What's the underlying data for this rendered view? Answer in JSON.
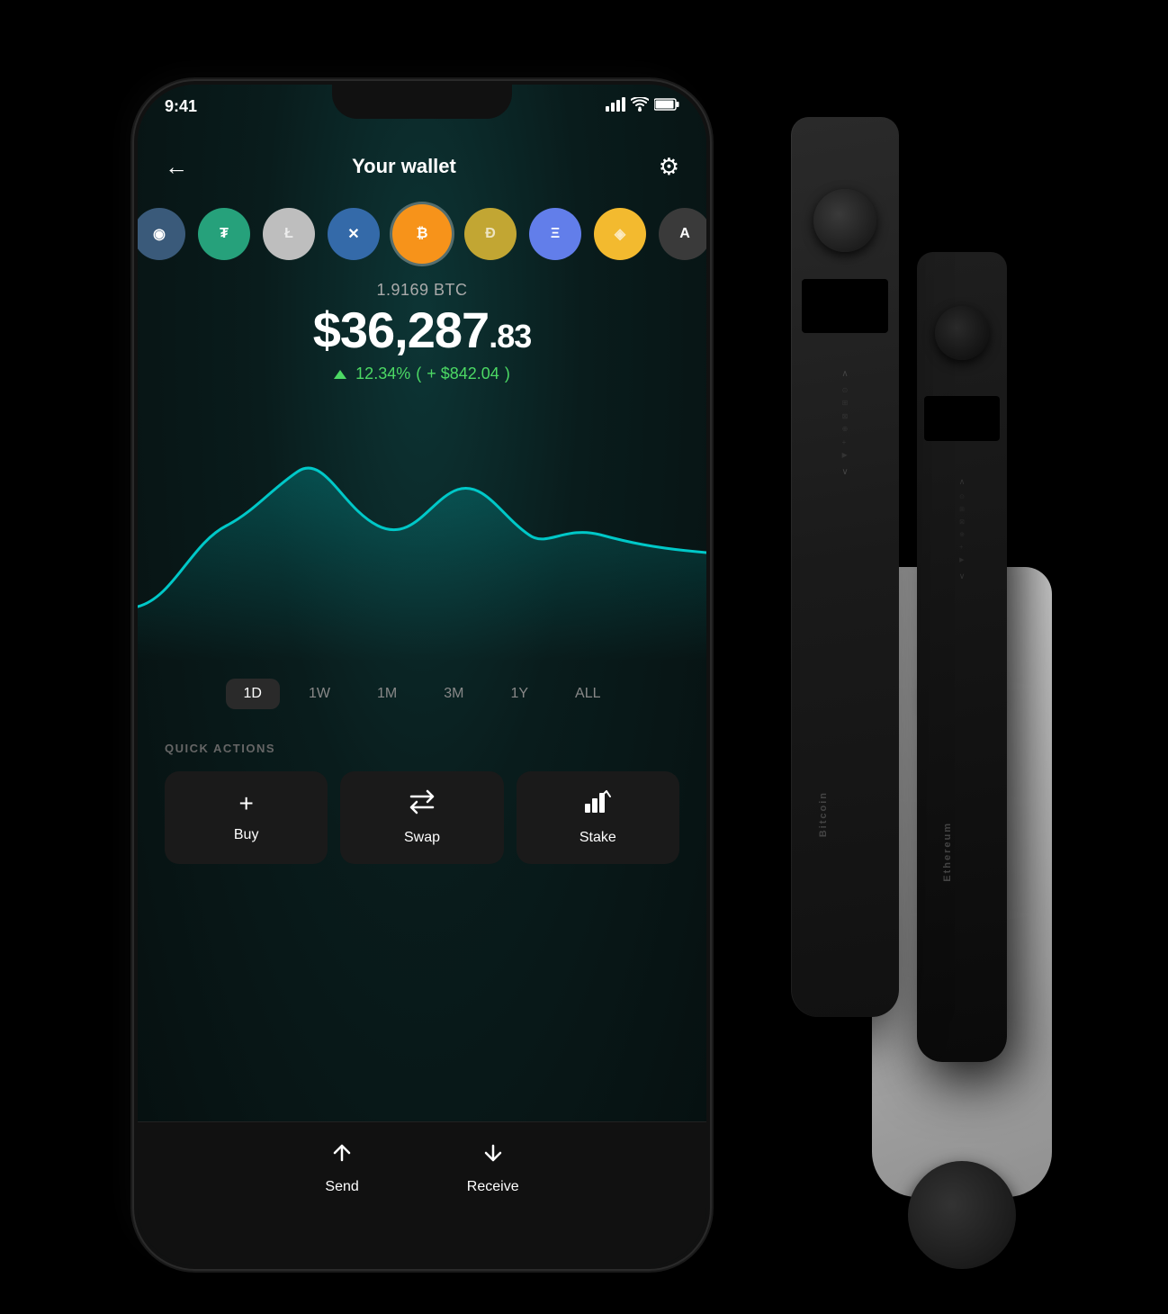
{
  "status_bar": {
    "time": "9:41",
    "signal": "▐▌▌",
    "wifi": "WiFi",
    "battery": "Battery"
  },
  "header": {
    "back_label": "←",
    "title": "Your wallet",
    "settings_label": "⚙"
  },
  "coins": [
    {
      "id": "other",
      "symbol": "◉",
      "class": "coin-other",
      "active": false
    },
    {
      "id": "usdt",
      "symbol": "₮",
      "class": "coin-usdt",
      "active": false
    },
    {
      "id": "ltc",
      "symbol": "Ł",
      "class": "coin-ltc",
      "active": false
    },
    {
      "id": "xrp",
      "symbol": "✕",
      "class": "coin-xrp",
      "active": false
    },
    {
      "id": "btc",
      "symbol": "₿",
      "class": "coin-btc",
      "active": true
    },
    {
      "id": "doge",
      "symbol": "Ð",
      "class": "coin-doge",
      "active": false
    },
    {
      "id": "eth",
      "symbol": "Ξ",
      "class": "coin-eth",
      "active": false
    },
    {
      "id": "bnb",
      "symbol": "◈",
      "class": "coin-bnb",
      "active": false
    },
    {
      "id": "algo",
      "symbol": "A",
      "class": "coin-algo",
      "active": false
    }
  ],
  "balance": {
    "btc_amount": "1.9169 BTC",
    "usd_whole": "$36,287",
    "usd_cents": ".83",
    "change_percent": "12.34%",
    "change_usd": "+ $842.04"
  },
  "chart": {
    "label": "Price chart"
  },
  "time_periods": [
    {
      "label": "1D",
      "active": true
    },
    {
      "label": "1W",
      "active": false
    },
    {
      "label": "1M",
      "active": false
    },
    {
      "label": "3M",
      "active": false
    },
    {
      "label": "1Y",
      "active": false
    },
    {
      "label": "ALL",
      "active": false
    }
  ],
  "quick_actions": {
    "section_label": "QUICK ACTIONS",
    "buttons": [
      {
        "id": "buy",
        "icon": "+",
        "label": "Buy"
      },
      {
        "id": "swap",
        "icon": "⇄",
        "label": "Swap"
      },
      {
        "id": "stake",
        "icon": "↑↑↑",
        "label": "Stake"
      }
    ]
  },
  "bottom_bar": {
    "send": {
      "icon": "↑",
      "label": "Send"
    },
    "receive": {
      "icon": "↓",
      "label": "Receive"
    }
  }
}
